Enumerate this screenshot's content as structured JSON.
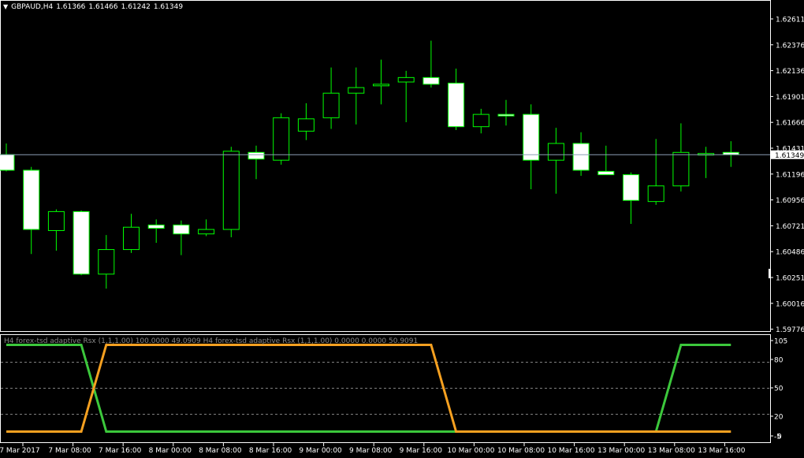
{
  "header": {
    "menu_icon": "triangle-down-icon",
    "symbol": "GBPAUD,H4",
    "open": "1.61366",
    "high": "1.61466",
    "low": "1.61242",
    "close": "1.61349"
  },
  "indicator_label": "H4 forex-tsd adaptive Rsx (1,1,1.00) 100.0000 49.0909  H4 forex-tsd adaptive Rsx (1,1,1.00) 0.0000 0.0000 50.9091",
  "price_axis_labels": [
    "1.62611",
    "1.62376",
    "1.62136",
    "1.61901",
    "1.61666",
    "1.61431",
    "1.61196",
    "1.60956",
    "1.60721",
    "1.60486",
    "1.60251",
    "1.60016",
    "1.59776"
  ],
  "current_price_label": "1.61349",
  "indicator_axis_labels": [
    "105",
    "80",
    "50",
    "20",
    "-5",
    "0"
  ],
  "time_axis_labels": [
    "7 Mar 2017",
    "7 Mar 08:00",
    "7 Mar 16:00",
    "8 Mar 00:00",
    "8 Mar 08:00",
    "8 Mar 16:00",
    "9 Mar 00:00",
    "9 Mar 08:00",
    "9 Mar 16:00",
    "10 Mar 00:00",
    "10 Mar 08:00",
    "10 Mar 16:00",
    "13 Mar 00:00",
    "13 Mar 08:00",
    "13 Mar 16:00"
  ],
  "colors": {
    "background": "#000000",
    "bull_candle": "#000000",
    "bear_candle": "#ffffff",
    "wick": "#00ff00",
    "rsx_line_1": "#3cc83c",
    "rsx_line_2": "#f5a020",
    "grid": "#808080",
    "price_line": "#8c9eb4"
  },
  "chart_data": [
    {
      "type": "candlestick",
      "title": "GBPAUD,H4",
      "ylim": [
        1.5977,
        1.6272
      ],
      "current_price": 1.61349,
      "candles": [
        {
          "o": 1.6135,
          "h": 1.6145,
          "l": 1.612,
          "c": 1.6121
        },
        {
          "o": 1.6121,
          "h": 1.6124,
          "l": 1.6046,
          "c": 1.6068
        },
        {
          "o": 1.6067,
          "h": 1.6086,
          "l": 1.6049,
          "c": 1.6084
        },
        {
          "o": 1.6084,
          "h": 1.6085,
          "l": 1.6027,
          "c": 1.6028
        },
        {
          "o": 1.6028,
          "h": 1.6063,
          "l": 1.6015,
          "c": 1.605
        },
        {
          "o": 1.605,
          "h": 1.6082,
          "l": 1.6047,
          "c": 1.607
        },
        {
          "o": 1.6072,
          "h": 1.6077,
          "l": 1.6056,
          "c": 1.6069
        },
        {
          "o": 1.6072,
          "h": 1.6076,
          "l": 1.6045,
          "c": 1.6064
        },
        {
          "o": 1.6064,
          "h": 1.6077,
          "l": 1.6062,
          "c": 1.6068
        },
        {
          "o": 1.6068,
          "h": 1.6142,
          "l": 1.6061,
          "c": 1.6138
        },
        {
          "o": 1.6137,
          "h": 1.6143,
          "l": 1.6113,
          "c": 1.6131
        },
        {
          "o": 1.613,
          "h": 1.6172,
          "l": 1.6126,
          "c": 1.6168
        },
        {
          "o": 1.6156,
          "h": 1.6181,
          "l": 1.6148,
          "c": 1.6167
        },
        {
          "o": 1.6168,
          "h": 1.6213,
          "l": 1.6158,
          "c": 1.619
        },
        {
          "o": 1.619,
          "h": 1.6213,
          "l": 1.6162,
          "c": 1.6195
        },
        {
          "o": 1.6197,
          "h": 1.622,
          "l": 1.618,
          "c": 1.6198
        },
        {
          "o": 1.62,
          "h": 1.621,
          "l": 1.6164,
          "c": 1.6204
        },
        {
          "o": 1.6204,
          "h": 1.6237,
          "l": 1.6195,
          "c": 1.6198
        },
        {
          "o": 1.6199,
          "h": 1.6212,
          "l": 1.6157,
          "c": 1.616
        },
        {
          "o": 1.616,
          "h": 1.6176,
          "l": 1.6154,
          "c": 1.6171
        },
        {
          "o": 1.6171,
          "h": 1.6184,
          "l": 1.6161,
          "c": 1.6171
        },
        {
          "o": 1.6171,
          "h": 1.618,
          "l": 1.6104,
          "c": 1.613
        },
        {
          "o": 1.613,
          "h": 1.6159,
          "l": 1.61,
          "c": 1.6145
        },
        {
          "o": 1.6145,
          "h": 1.6155,
          "l": 1.6116,
          "c": 1.6121
        },
        {
          "o": 1.612,
          "h": 1.6143,
          "l": 1.6118,
          "c": 1.6117
        },
        {
          "o": 1.6117,
          "h": 1.6119,
          "l": 1.6073,
          "c": 1.6094
        },
        {
          "o": 1.6093,
          "h": 1.6149,
          "l": 1.609,
          "c": 1.6107
        },
        {
          "o": 1.6107,
          "h": 1.6163,
          "l": 1.6102,
          "c": 1.6137
        },
        {
          "o": 1.6135,
          "h": 1.6142,
          "l": 1.6114,
          "c": 1.6136
        },
        {
          "o": 1.6137,
          "h": 1.6147,
          "l": 1.6124,
          "c": 1.6135
        }
      ]
    },
    {
      "type": "line",
      "ylim": [
        -5,
        105
      ],
      "x": [
        0,
        1,
        2,
        3,
        4,
        5,
        6,
        7,
        8,
        9,
        10,
        11,
        12,
        13,
        14,
        15,
        16,
        17,
        18,
        19,
        20,
        21,
        22,
        23,
        24,
        25,
        26,
        27,
        28,
        29
      ],
      "series": [
        {
          "values": [
            100,
            100,
            100,
            100,
            0,
            0,
            0,
            0,
            0,
            0,
            0,
            0,
            0,
            0,
            0,
            0,
            0,
            0,
            0,
            0,
            0,
            0,
            0,
            0,
            0,
            0,
            0,
            100,
            100,
            100
          ]
        },
        {
          "values": [
            0,
            0,
            0,
            0,
            100,
            100,
            100,
            100,
            100,
            100,
            100,
            100,
            100,
            100,
            100,
            100,
            100,
            100,
            0,
            0,
            0,
            0,
            0,
            0,
            0,
            0,
            0,
            0,
            0,
            0
          ]
        }
      ],
      "grid_levels": [
        80,
        50,
        20
      ]
    }
  ]
}
